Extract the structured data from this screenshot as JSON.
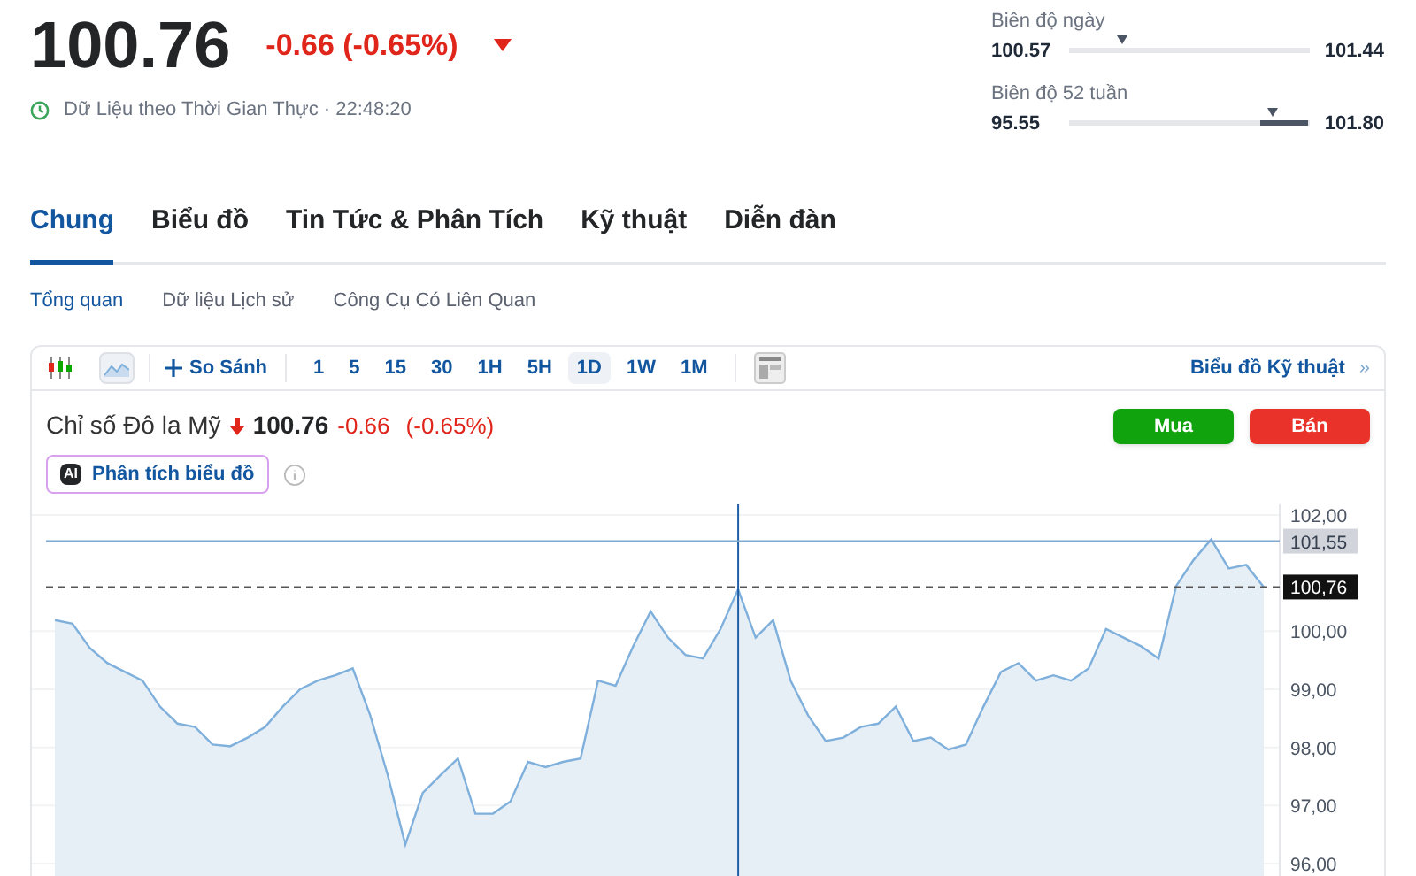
{
  "quote": {
    "price": "100.76",
    "change": "-0.66 (-0.65%)",
    "status": "Dữ Liệu theo Thời Gian Thực · 22:48:20"
  },
  "ranges": [
    {
      "label": "Biên độ ngày",
      "low": "100.57",
      "high": "101.44",
      "level": 0.22,
      "kind": "plain"
    },
    {
      "label": "Biên độ 52 tuần",
      "low": "95.55",
      "high": "101.80",
      "level": 0.84,
      "kind": "band"
    }
  ],
  "tabs": [
    {
      "label": "Chung",
      "selected": true
    },
    {
      "label": "Biểu đồ",
      "selected": false
    },
    {
      "label": "Tin Tức & Phân Tích",
      "selected": false
    },
    {
      "label": "Kỹ thuật",
      "selected": false
    },
    {
      "label": "Diễn đàn",
      "selected": false
    }
  ],
  "subtabs": [
    {
      "label": "Tổng quan",
      "selected": true
    },
    {
      "label": "Dữ liệu Lịch sử",
      "selected": false
    },
    {
      "label": "Công Cụ Có Liên Quan",
      "selected": false
    }
  ],
  "toolbar": {
    "compare": "So Sánh",
    "timeframes": [
      {
        "label": "1",
        "selected": false
      },
      {
        "label": "5",
        "selected": false
      },
      {
        "label": "15",
        "selected": false
      },
      {
        "label": "30",
        "selected": false
      },
      {
        "label": "1H",
        "selected": false
      },
      {
        "label": "5H",
        "selected": false
      },
      {
        "label": "1D",
        "selected": true
      },
      {
        "label": "1W",
        "selected": false
      },
      {
        "label": "1M",
        "selected": false
      }
    ],
    "technical_link": "Biểu đồ Kỹ thuật",
    "technical_arrow": "»"
  },
  "instrument": {
    "name": "Chỉ số Đô la Mỹ",
    "price": "100.76",
    "change": "-0.66",
    "percent": "(-0.65%)"
  },
  "buttons": [
    {
      "label": "Mua",
      "kind": "buy"
    },
    {
      "label": "Bán",
      "kind": "sell"
    }
  ],
  "ai_button": {
    "label": "Phân tích biểu đồ",
    "badge": "AI"
  },
  "chart": {
    "chart_data": {
      "type": "area",
      "ylim": [
        96,
        102
      ],
      "grid": true,
      "yticks": [
        {
          "value": 102,
          "label": "102,00"
        },
        {
          "value": 100,
          "label": "100,00"
        },
        {
          "value": 99,
          "label": "99,00"
        },
        {
          "value": 98,
          "label": "98,00"
        },
        {
          "value": 97,
          "label": "97,00"
        },
        {
          "value": 96,
          "label": "96,00"
        }
      ],
      "series": [
        {
          "color": "#7fb0dc",
          "values": [
            100.19,
            100.13,
            99.71,
            99.45,
            99.3,
            99.15,
            98.7,
            98.41,
            98.35,
            98.05,
            98.02,
            98.17,
            98.35,
            98.7,
            99.0,
            99.15,
            99.24,
            99.36,
            98.55,
            97.52,
            96.33,
            97.22,
            97.52,
            97.81,
            96.86,
            96.86,
            97.07,
            97.75,
            97.66,
            97.75,
            97.81,
            99.15,
            99.06,
            99.74,
            100.34,
            99.89,
            99.59,
            99.53,
            100.04,
            100.72,
            99.89,
            100.19,
            99.15,
            98.55,
            98.11,
            98.17,
            98.35,
            98.41,
            98.7,
            98.11,
            98.17,
            97.96,
            98.05,
            98.7,
            99.3,
            99.45,
            99.15,
            99.24,
            99.15,
            99.36,
            100.04,
            99.89,
            99.74,
            99.53,
            100.78,
            101.23,
            101.58,
            101.08,
            101.14,
            100.76
          ]
        }
      ],
      "ref_lines": [
        {
          "axis": "y",
          "value": 101.55,
          "label": "101,55"
        },
        {
          "axis": "y",
          "value": 100.76,
          "label": "100,76"
        }
      ]
    }
  }
}
